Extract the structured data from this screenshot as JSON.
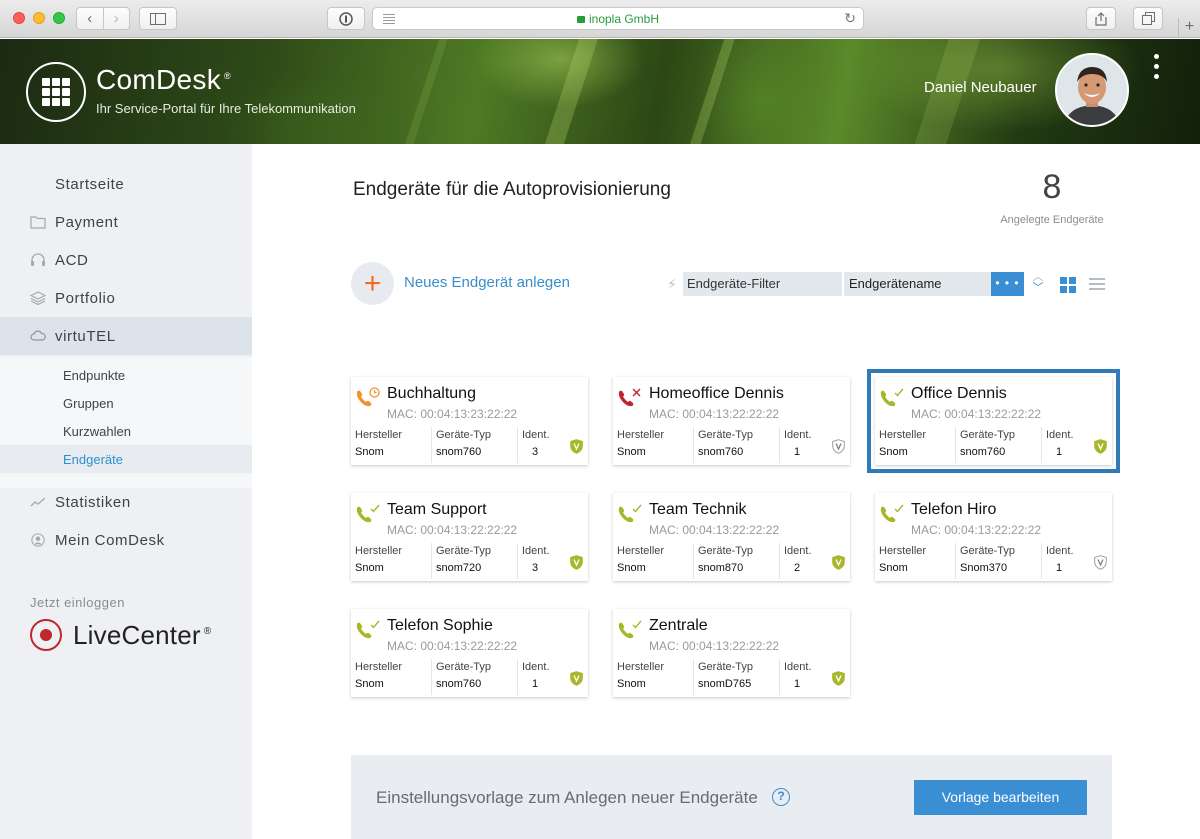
{
  "browser": {
    "url_text": "inopla GmbH"
  },
  "header": {
    "brand": "ComDesk",
    "brand_mark": "®",
    "tagline": "Ihr Service-Portal für Ihre Telekommunikation",
    "user_name": "Daniel Neubauer"
  },
  "sidebar": {
    "items": [
      {
        "label": "Startseite",
        "icon": "none"
      },
      {
        "label": "Payment",
        "icon": "folder-icon"
      },
      {
        "label": "ACD",
        "icon": "headset-icon"
      },
      {
        "label": "Portfolio",
        "icon": "layers-icon"
      },
      {
        "label": "virtuTEL",
        "icon": "cloud-icon",
        "active": true
      },
      {
        "label": "Statistiken",
        "icon": "chart-line-icon"
      },
      {
        "label": "Mein ComDesk",
        "icon": "user-icon"
      }
    ],
    "sub_items": [
      {
        "label": "Endpunkte"
      },
      {
        "label": "Gruppen"
      },
      {
        "label": "Kurzwahlen"
      },
      {
        "label": "Endgeräte",
        "active": true
      }
    ],
    "login_label": "Jetzt einloggen",
    "livecenter": "LiveCenter",
    "livecenter_mark": "®"
  },
  "main": {
    "title": "Endgeräte für die Autoprovisionierung",
    "count": "8",
    "count_label": "Angelegte Endgeräte",
    "add_label": "Neues Endgerät anlegen",
    "filter_label": "Endgeräte-Filter",
    "filter_select": "Endgerätename",
    "filter_more": "• • •"
  },
  "card_labels": {
    "hersteller": "Hersteller",
    "typ": "Geräte-Typ",
    "ident": "Ident."
  },
  "devices": [
    {
      "name": "Buchhaltung",
      "mac": "MAC: 00:04:13:23:22:22",
      "hersteller": "Snom",
      "typ": "snom760",
      "ident": "3",
      "status": "pending",
      "verified": true
    },
    {
      "name": "Homeoffice Dennis",
      "mac": "MAC: 00:04:13:22:22:22",
      "hersteller": "Snom",
      "typ": "snom760",
      "ident": "1",
      "status": "error",
      "verified": false
    },
    {
      "name": "Office Dennis",
      "mac": "MAC: 00:04:13:22:22:22",
      "hersteller": "Snom",
      "typ": "snom760",
      "ident": "1",
      "status": "ok",
      "verified": true,
      "selected": true
    },
    {
      "name": "Team Support",
      "mac": "MAC: 00:04:13:22:22:22",
      "hersteller": "Snom",
      "typ": "snom720",
      "ident": "3",
      "status": "ok",
      "verified": true
    },
    {
      "name": "Team Technik",
      "mac": "MAC: 00:04:13:22:22:22",
      "hersteller": "Snom",
      "typ": "snom870",
      "ident": "2",
      "status": "ok",
      "verified": true
    },
    {
      "name": "Telefon Hiro",
      "mac": "MAC: 00:04:13:22:22:22",
      "hersteller": "Snom",
      "typ": "Snom370",
      "ident": "1",
      "status": "ok",
      "verified": false
    },
    {
      "name": "Telefon Sophie",
      "mac": "MAC: 00:04:13:22:22:22",
      "hersteller": "Snom",
      "typ": "snom760",
      "ident": "1",
      "status": "ok",
      "verified": true
    },
    {
      "name": "Zentrale",
      "mac": "MAC: 00:04:13:22:22:22",
      "hersteller": "Snom",
      "typ": "snomD765",
      "ident": "1",
      "status": "ok",
      "verified": true
    }
  ],
  "bottom": {
    "text": "Einstellungsvorlage zum Anlegen neuer Endgeräte",
    "help": "?",
    "button": "Vorlage bearbeiten"
  },
  "colors": {
    "accent": "#3a8ed4",
    "ok": "#a8b62a",
    "pending": "#f0932b",
    "error": "#c0262d",
    "livecenter": "#c0262d"
  }
}
